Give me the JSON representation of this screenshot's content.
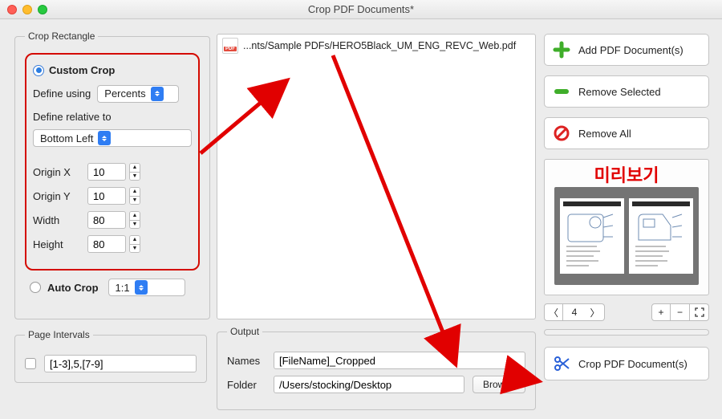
{
  "window": {
    "title": "Crop PDF Documents*"
  },
  "cropRect": {
    "legend": "Crop Rectangle",
    "customLabel": "Custom Crop",
    "defineUsingLabel": "Define using",
    "defineUsingValue": "Percents",
    "defineRelativeLabel": "Define relative to",
    "defineRelativeValue": "Bottom Left",
    "originXLabel": "Origin X",
    "originX": "10",
    "originYLabel": "Origin Y",
    "originY": "10",
    "widthLabel": "Width",
    "width": "80",
    "heightLabel": "Height",
    "height": "80",
    "autoCropLabel": "Auto Crop",
    "autoCropRatio": "1:1"
  },
  "pageIntervals": {
    "legend": "Page Intervals",
    "value": "[1-3],5,[7-9]"
  },
  "fileList": {
    "items": [
      "...nts/Sample PDFs/HERO5Black_UM_ENG_REVC_Web.pdf"
    ],
    "pdfBadge": "PDF"
  },
  "output": {
    "legend": "Output",
    "namesLabel": "Names",
    "namesValue": "[FileName]_Cropped",
    "folderLabel": "Folder",
    "folderValue": "/Users/stocking/Desktop",
    "browseLabel": "Browse"
  },
  "rightButtons": {
    "add": "Add PDF Document(s)",
    "removeSel": "Remove Selected",
    "removeAll": "Remove All",
    "crop": "Crop PDF Document(s)"
  },
  "preview": {
    "label": "미리보기",
    "page": "4"
  }
}
